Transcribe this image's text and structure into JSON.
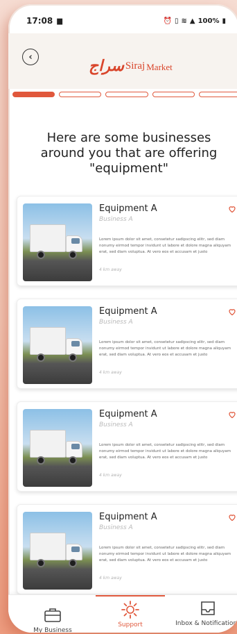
{
  "status_bar": {
    "time": "17:08",
    "battery": "100%"
  },
  "header": {
    "back_icon": "chevron-left-icon",
    "logo_mark": "سراج",
    "logo_siraj": "Siraj",
    "logo_market": "Market"
  },
  "progress": {
    "total_steps": 5,
    "current_step": 1
  },
  "heading": "Here are some businesses around you that are offering \"equipment\"",
  "listings": [
    {
      "title": "Equipment A",
      "business": "Business A",
      "description": "Lorem ipsum dolor sit amet, consetetur sadipscing elitr, sed diam nonumy eirmod tempor invidunt ut labore et dolore magna aliquyam erat, sed diam voluptua. At vero eos et accusam et justo",
      "distance": "4 km away"
    },
    {
      "title": "Equipment A",
      "business": "Business A",
      "description": "Lorem ipsum dolor sit amet, consetetur sadipscing elitr, sed diam nonumy eirmod tempor invidunt ut labore et dolore magna aliquyam erat, sed diam voluptua. At vero eos et accusam et justo",
      "distance": "4 km away"
    },
    {
      "title": "Equipment A",
      "business": "Business A",
      "description": "Lorem ipsum dolor sit amet, consetetur sadipscing elitr, sed diam nonumy eirmod tempor invidunt ut labore et dolore magna aliquyam erat, sed diam voluptua. At vero eos et accusam et justo",
      "distance": "4 km away"
    },
    {
      "title": "Equipment A",
      "business": "Business A",
      "description": "Lorem ipsum dolor sit amet, consetetur sadipscing elitr, sed diam nonumy eirmod tempor invidunt ut labore et dolore magna aliquyam erat, sed diam voluptua. At vero eos et accusam et justo",
      "distance": "4 km away"
    }
  ],
  "bottom_nav": {
    "items": [
      {
        "label": "My Business",
        "icon": "briefcase-icon"
      },
      {
        "label": "Support",
        "icon": "gear-support-icon",
        "active": true
      },
      {
        "label": "Inbox & Notifications",
        "icon": "inbox-tray-icon"
      }
    ]
  },
  "colors": {
    "accent": "#e0583c",
    "header_bg": "#f7f3ef"
  }
}
